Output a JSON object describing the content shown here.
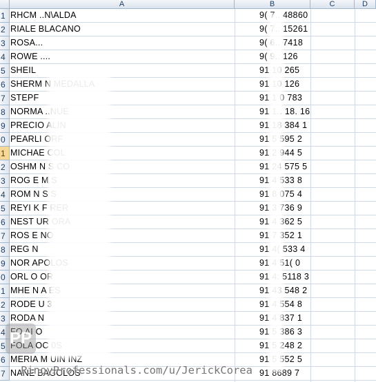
{
  "columns": [
    "A",
    "B",
    "C",
    "D"
  ],
  "rows": [
    {
      "num": "1",
      "a": "RHCM   ..N\\ALDA",
      "b": "9( 7.. 48860"
    },
    {
      "num": "2",
      "a": "RIALE     BLACANO",
      "b": "9( 7.. 15261"
    },
    {
      "num": "3",
      "a": "ROSA...",
      "b": "9( 6.. 7418"
    },
    {
      "num": "4",
      "a": "ROWE  ....",
      "b": "9( 9.. 126"
    },
    {
      "num": "5",
      "a": "SHEIL",
      "b": "91 10 265"
    },
    {
      "num": "6",
      "a": "SHERM    N MEDALLA",
      "b": "91 10 126"
    },
    {
      "num": "7",
      "a": "STEPF",
      "b": "91 1 0 783"
    },
    {
      "num": "8",
      "a": "NORMA   ..NUE",
      "b": "91 1.. 18. 16"
    },
    {
      "num": "9",
      "a": "PRECIO    ALIN",
      "b": "91 18 384 1"
    },
    {
      "num": "0",
      "a": "PEARLI      ORF",
      "b": "91 5 595 2"
    },
    {
      "num": "1",
      "a": "MICHAE    COL",
      "b": "91 2 944 5"
    },
    {
      "num": "2",
      "a": "OSHM    N S     CO",
      "b": "91 24 575 5"
    },
    {
      "num": "3",
      "a": "ROG    E  M  S",
      "b": "91 4 533 8"
    },
    {
      "num": "4",
      "a": "ROM    N S   S",
      "b": "91 8 075 4"
    },
    {
      "num": "5",
      "a": "REYI    K F  RER",
      "b": "91 3 736 9"
    },
    {
      "num": "6",
      "a": "NEST    UR   ORA",
      "b": "91 4 362 5"
    },
    {
      "num": "7",
      "a": "ROS    E    NO",
      "b": "91 7 352 1"
    },
    {
      "num": "8",
      "a": "REG       N",
      "b": "91 4( 533 4"
    },
    {
      "num": "9",
      "a": "NOR       APOLOS",
      "b": "91 4 51( 0"
    },
    {
      "num": "0",
      "a": "ORL     O  OR",
      "b": "91 4: 5118 3"
    },
    {
      "num": "1",
      "a": "MHE     N    A  ES",
      "b": "91 43 548 2"
    },
    {
      "num": "2",
      "a": "RODE     U   3",
      "b": "91 4 554 8"
    },
    {
      "num": "3",
      "a": "RODA    N",
      "b": "91 4 837 1"
    },
    {
      "num": "4",
      "a": "FO      AI    O",
      "b": "91 5 386 3"
    },
    {
      "num": "5",
      "a": "FOLA   OC    0S",
      "b": "91 5 248 2"
    },
    {
      "num": "6",
      "a": "MERIA  M   UIN  INZ",
      "b": "91  5 552 5"
    },
    {
      "num": "7",
      "a": "NANE    BAGOLOS",
      "b": "91 8689 7"
    }
  ],
  "selected_row_index": 10,
  "watermark": {
    "logo_text": "PP",
    "caption": "PinoyProfessionals.com/u/JerickCorea"
  }
}
